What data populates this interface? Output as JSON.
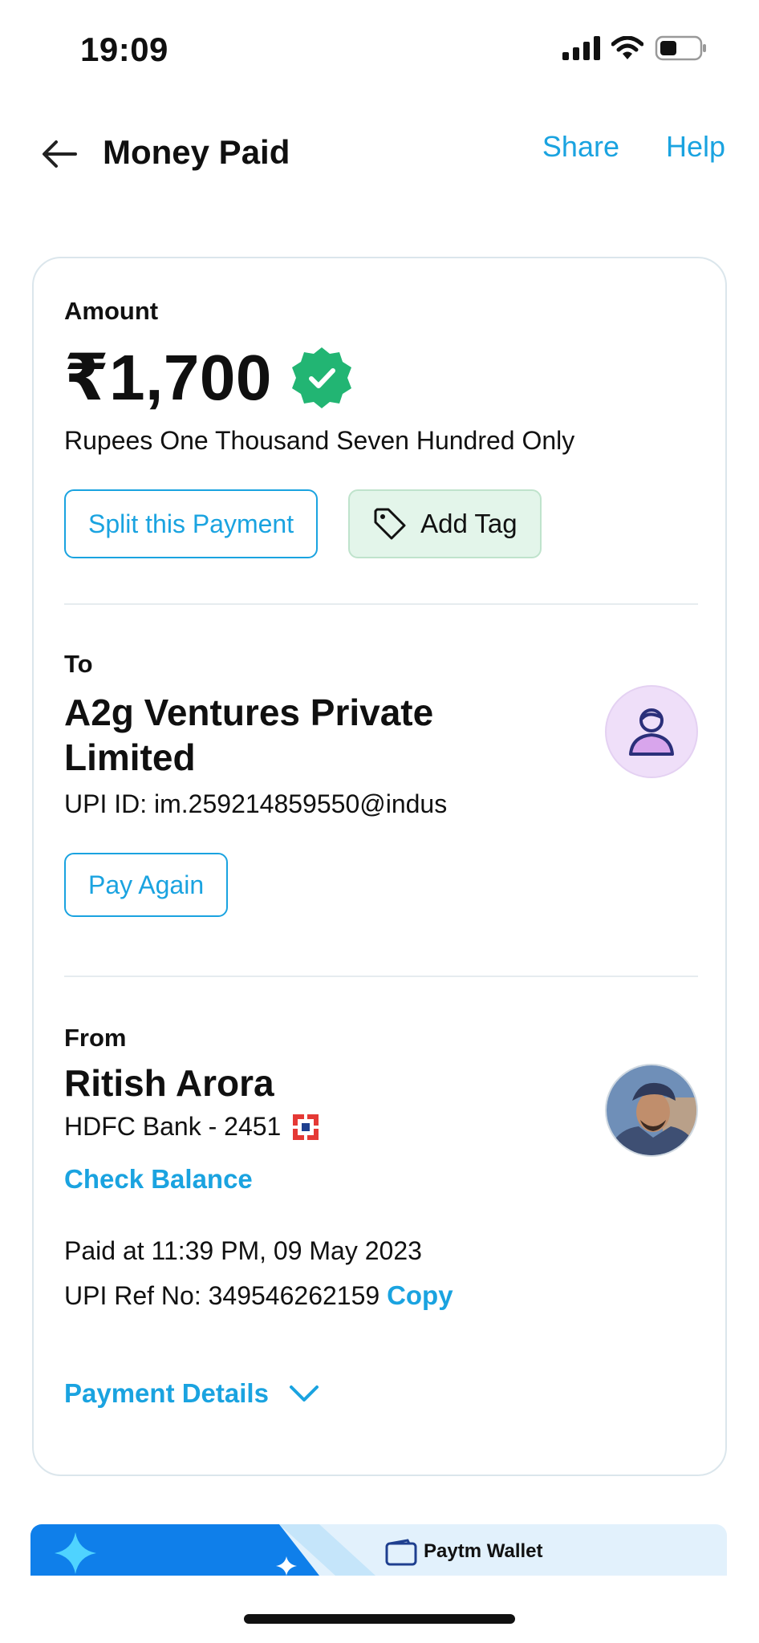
{
  "status_bar": {
    "time": "19:09"
  },
  "header": {
    "title": "Money Paid",
    "share_label": "Share",
    "help_label": "Help"
  },
  "amount_section": {
    "label": "Amount",
    "amount": "₹1,700",
    "amount_in_words": "Rupees One Thousand Seven Hundred Only",
    "split_label": "Split this Payment",
    "add_tag_label": "Add Tag"
  },
  "to_section": {
    "label": "To",
    "name": "A2g Ventures Private Limited",
    "upi_id": "UPI ID: im.259214859550@indus",
    "pay_again_label": "Pay Again"
  },
  "from_section": {
    "label": "From",
    "name": "Ritish Arora",
    "bank": "HDFC Bank - 2451",
    "check_balance_label": "Check Balance",
    "paid_at": "Paid at 11:39 PM, 09 May 2023",
    "upi_ref": "UPI Ref No: 349546262159",
    "copy_label": "Copy",
    "payment_details_label": "Payment Details"
  },
  "promo": {
    "wallet_label": "Paytm Wallet"
  },
  "colors": {
    "accent": "#1aa3e0",
    "success": "#22b573",
    "tag_bg": "#e3f5ea"
  }
}
